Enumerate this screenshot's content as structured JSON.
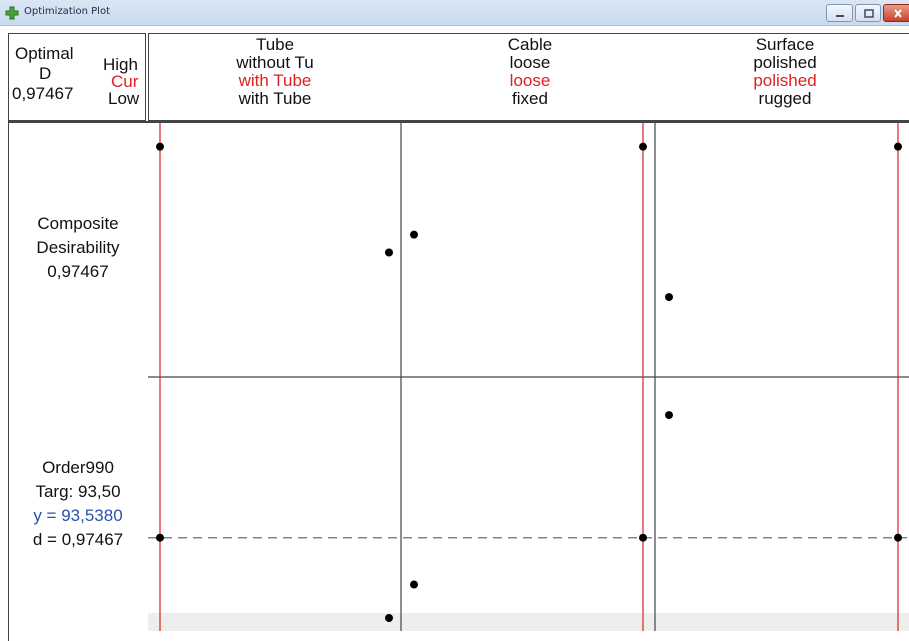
{
  "window": {
    "title": "Optimization Plot",
    "accent": "#c7432c"
  },
  "header_left": {
    "optimal_label": "Optimal",
    "d_label": "D",
    "d_value": "0,97467",
    "high_label": "High",
    "cur_label": "Cur",
    "low_label": "Low"
  },
  "factors": [
    {
      "name": "Tube",
      "high": "without Tu",
      "cur": "with Tube",
      "low": "with Tube"
    },
    {
      "name": "Cable",
      "high": "loose",
      "cur": "loose",
      "low": "fixed"
    },
    {
      "name": "Surface",
      "high": "polished",
      "cur": "polished",
      "low": "rugged"
    }
  ],
  "rows": [
    {
      "title": "Composite",
      "subtitle": "Desirability",
      "value": "0,97467"
    },
    {
      "title": "Order990",
      "target": "Targ: 93,50",
      "y": "y = 93,5380",
      "d": "d = 0,97467"
    }
  ],
  "colors": {
    "current_line": "#e02020",
    "reference_line": "#5b6f96",
    "y_text": "#2a52a8",
    "axis": "#444444"
  },
  "chart_data": {
    "type": "scatter",
    "panels": [
      {
        "row": "desirability",
        "factor": "Tube",
        "levels": [
          "without Tu",
          "with Tube"
        ],
        "current": 0,
        "values": [
          0.97467,
          0.5
        ]
      },
      {
        "row": "desirability",
        "factor": "Cable",
        "levels": [
          "fixed",
          "loose"
        ],
        "current": 1,
        "values": [
          0.58,
          0.97467
        ]
      },
      {
        "row": "desirability",
        "factor": "Surface",
        "levels": [
          "rugged",
          "polished"
        ],
        "current": 1,
        "values": [
          0.3,
          0.97467
        ]
      },
      {
        "row": "response",
        "factor": "Tube",
        "levels": [
          "without Tu",
          "with Tube"
        ],
        "current": 0,
        "values": [
          0.36,
          0.0
        ]
      },
      {
        "row": "response",
        "factor": "Cable",
        "levels": [
          "fixed",
          "loose"
        ],
        "current": 1,
        "values": [
          0.15,
          0.36
        ]
      },
      {
        "row": "response",
        "factor": "Surface",
        "levels": [
          "rugged",
          "polished"
        ],
        "current": 1,
        "values": [
          0.91,
          0.36
        ]
      }
    ],
    "response_reference": 0.36,
    "ylim": [
      0,
      1
    ]
  }
}
